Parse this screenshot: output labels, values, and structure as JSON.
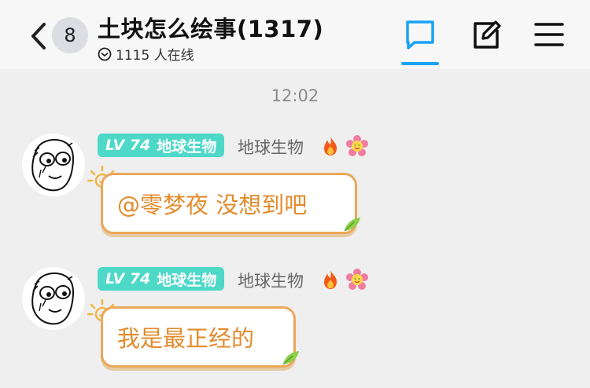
{
  "header": {
    "unread_count": "8",
    "title": "土块怎么绘事(1317)",
    "online_count": "1115 人在线"
  },
  "chat": {
    "timestamp": "12:02",
    "messages": [
      {
        "level": "LV 74",
        "badge_label": "地球生物",
        "username": "地球生物",
        "text": "@零梦夜 没想到吧"
      },
      {
        "level": "LV 74",
        "badge_label": "地球生物",
        "username": "地球生物",
        "text": "我是最正经的"
      }
    ]
  },
  "colors": {
    "accent": "#1aa3f5",
    "badge": "#4ed8c8",
    "bubble_border": "#eaa85a",
    "bubble_text": "#e28b2c"
  }
}
